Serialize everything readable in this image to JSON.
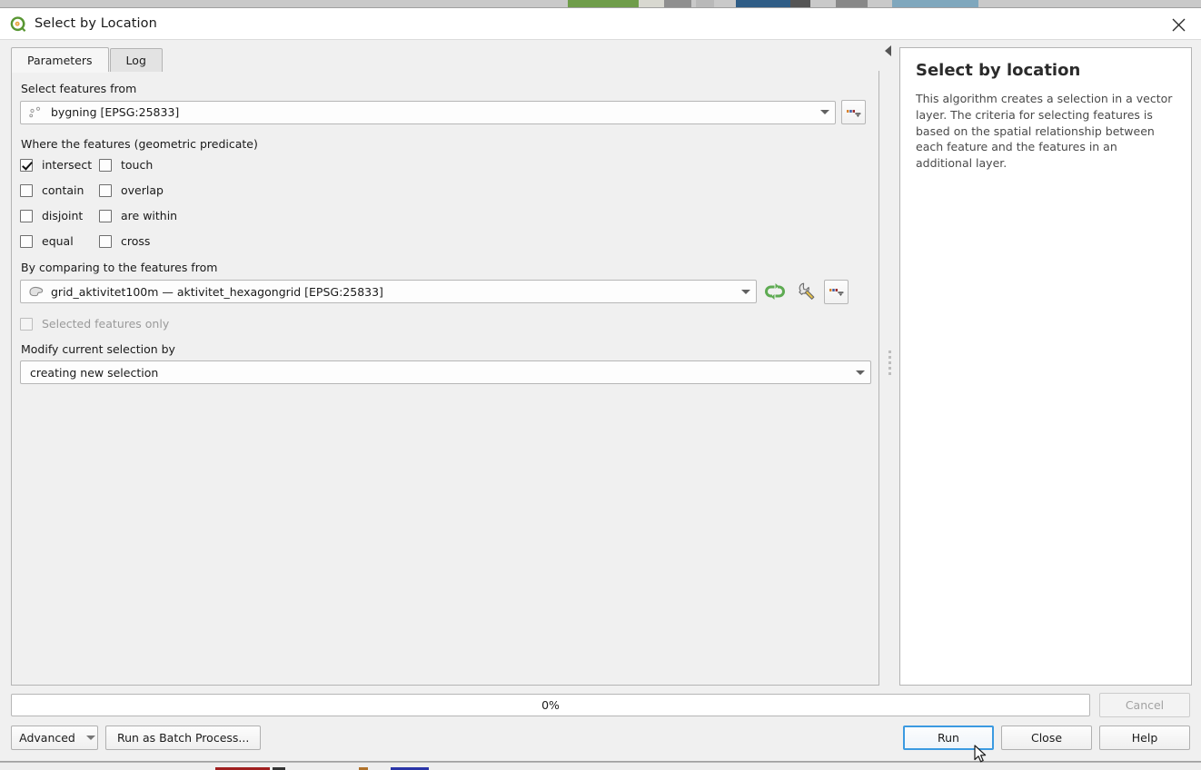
{
  "window": {
    "title": "Select by Location",
    "logo_icon": "qgis-logo-icon",
    "close_icon": "close-icon"
  },
  "tabs": [
    {
      "label": "Parameters",
      "active": true
    },
    {
      "label": "Log",
      "active": false
    }
  ],
  "parameters": {
    "input_layer": {
      "label": "Select features from",
      "value": "bygning [EPSG:25833]",
      "layer_icon": "point-layer-icon",
      "browse_icon": "dots-dropdown-icon",
      "browse_label": "..."
    },
    "predicate": {
      "label": "Where the features (geometric predicate)",
      "options": [
        {
          "label": "intersect",
          "checked": true,
          "enabled": true
        },
        {
          "label": "touch",
          "checked": false,
          "enabled": true
        },
        {
          "label": "contain",
          "checked": false,
          "enabled": true
        },
        {
          "label": "overlap",
          "checked": false,
          "enabled": true
        },
        {
          "label": "disjoint",
          "checked": false,
          "enabled": true
        },
        {
          "label": "are within",
          "checked": false,
          "enabled": true
        },
        {
          "label": "equal",
          "checked": false,
          "enabled": true
        },
        {
          "label": "cross",
          "checked": false,
          "enabled": true
        }
      ]
    },
    "compare_layer": {
      "label": "By comparing to the features from",
      "value": "grid_aktivitet100m — aktivitet_hexagongrid [EPSG:25833]",
      "layer_icon": "polygon-layer-icon",
      "iterate_icon": "iterate-refresh-icon",
      "override_icon": "wrench-icon",
      "browse_icon": "dots-dropdown-icon",
      "browse_label": "..."
    },
    "selected_only": {
      "label": "Selected features only",
      "checked": false,
      "enabled": false
    },
    "modify_selection": {
      "label": "Modify current selection by",
      "value": "creating new selection"
    }
  },
  "help": {
    "title": "Select by location",
    "body": "This algorithm creates a selection in a vector layer. The criteria for selecting features is based on the spatial relationship between each feature and the features in an additional layer.",
    "collapse_icon": "collapse-left-arrow-icon",
    "splitter_icon": "splitter-grip-icon"
  },
  "footer": {
    "progress": {
      "text": "0%",
      "percent": 0
    },
    "buttons": {
      "advanced": {
        "label": "Advanced",
        "enabled": true,
        "has_menu": true
      },
      "batch": {
        "label": "Run as Batch Process...",
        "enabled": true
      },
      "cancel": {
        "label": "Cancel",
        "enabled": false
      },
      "run": {
        "label": "Run",
        "enabled": true,
        "focused": true
      },
      "close": {
        "label": "Close",
        "enabled": true
      },
      "help": {
        "label": "Help",
        "enabled": true
      }
    }
  },
  "colors": {
    "accent_focus": "#3b9ae1",
    "qgis_green": "#589632",
    "qgis_orange": "#e8a33d",
    "iterate_green": "#5eab52",
    "panel_bg": "#f0f0f0",
    "field_bg": "#fdfdfd"
  }
}
